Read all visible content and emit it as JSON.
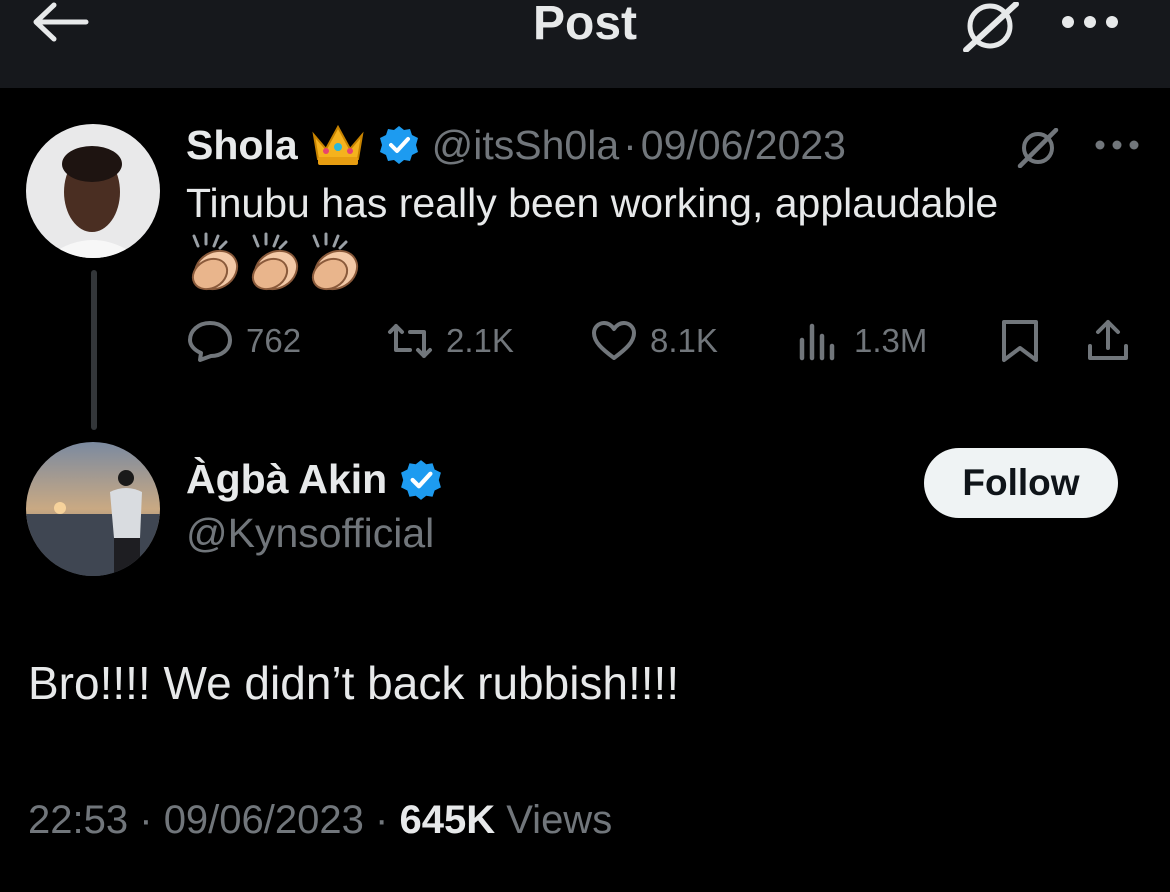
{
  "header": {
    "title": "Post",
    "back_icon": "arrow-left-icon",
    "grok_icon": "grok-icon",
    "more_icon": "more-horizontal-icon"
  },
  "colors": {
    "background": "#000000",
    "header_bg": "#16181c",
    "text": "#e7e9ea",
    "muted": "#71767b",
    "verified": "#1d9bf0",
    "follow_bg": "#eff3f4"
  },
  "parent_tweet": {
    "author_name": "Shola",
    "author_badge_emoji": "crown",
    "handle": "@itsSh0la",
    "separator": "·",
    "date": "09/06/2023",
    "text": "Tinubu has really been working, applaudable",
    "emojis": [
      "clapping-hands",
      "clapping-hands",
      "clapping-hands"
    ],
    "stats": {
      "replies": "762",
      "reposts": "2.1K",
      "likes": "8.1K",
      "views": "1.3M"
    }
  },
  "main_tweet": {
    "author_name": "Àgbà Akin",
    "handle": "@Kynsofficial",
    "follow_label": "Follow",
    "text": "Bro!!!! We didn’t back rubbish!!!!",
    "time": "22:53",
    "separator": "·",
    "date": "09/06/2023",
    "views_count": "645K",
    "views_label": "Views"
  }
}
